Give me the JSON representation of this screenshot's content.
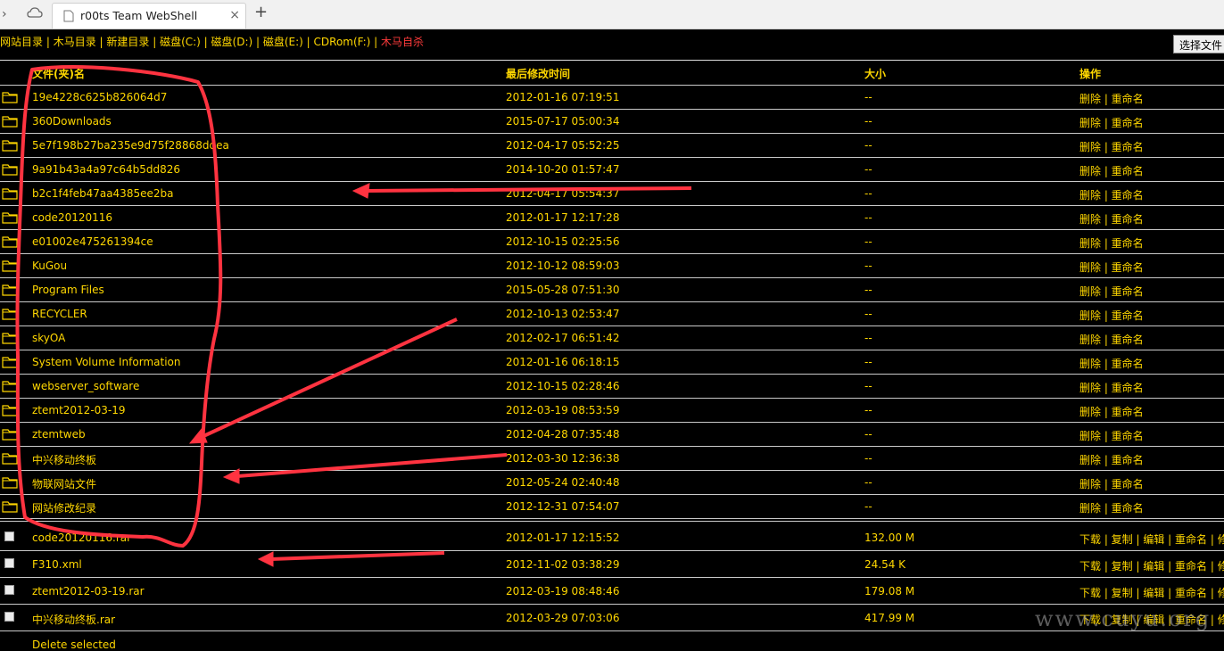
{
  "browser": {
    "tab_title": "r00ts Team WebShell",
    "close_glyph": "×",
    "new_tab_glyph": "+",
    "back_glyph": "›"
  },
  "nav": {
    "items": [
      "网站目录",
      "木马目录",
      "新建目录",
      "磁盘(C:)",
      "磁盘(D:)",
      "磁盘(E:)",
      "CDRom(F:)"
    ],
    "separator": " | ",
    "kill_label": "木马自杀",
    "kill_color": "#ff3b3b"
  },
  "file_button": "选择文件",
  "headers": {
    "name": "文件(夹)名",
    "time": "最后修改时间",
    "size": "大小",
    "ops": "操作"
  },
  "folder_ops": "删除 | 重命名",
  "folders": [
    {
      "name": "19e4228c625b826064d7",
      "time": "2012-01-16 07:19:51",
      "size": "--"
    },
    {
      "name": "360Downloads",
      "time": "2015-07-17 05:00:34",
      "size": "--"
    },
    {
      "name": "5e7f198b27ba235e9d75f28868ddea",
      "time": "2012-04-17 05:52:25",
      "size": "--"
    },
    {
      "name": "9a91b43a4a97c64b5dd826",
      "time": "2014-10-20 01:57:47",
      "size": "--"
    },
    {
      "name": "b2c1f4feb47aa4385ee2ba",
      "time": "2012-04-17 05:54:37",
      "size": "--"
    },
    {
      "name": "code20120116",
      "time": "2012-01-17 12:17:28",
      "size": "--"
    },
    {
      "name": "e01002e475261394ce",
      "time": "2012-10-15 02:25:56",
      "size": "--"
    },
    {
      "name": "KuGou",
      "time": "2012-10-12 08:59:03",
      "size": "--"
    },
    {
      "name": "Program Files",
      "time": "2015-05-28 07:51:30",
      "size": "--"
    },
    {
      "name": "RECYCLER",
      "time": "2012-10-13 02:53:47",
      "size": "--"
    },
    {
      "name": "skyOA",
      "time": "2012-02-17 06:51:42",
      "size": "--"
    },
    {
      "name": "System Volume Information",
      "time": "2012-01-16 06:18:15",
      "size": "--"
    },
    {
      "name": "webserver_software",
      "time": "2012-10-15 02:28:46",
      "size": "--"
    },
    {
      "name": "ztemt2012-03-19",
      "time": "2012-03-19 08:53:59",
      "size": "--"
    },
    {
      "name": "ztemtweb",
      "time": "2012-04-28 07:35:48",
      "size": "--"
    },
    {
      "name": "中兴移动终板",
      "time": "2012-03-30 12:36:38",
      "size": "--"
    },
    {
      "name": "物联网站文件",
      "time": "2012-05-24 02:40:48",
      "size": "--"
    },
    {
      "name": "网站修改纪录",
      "time": "2012-12-31 07:54:07",
      "size": "--"
    }
  ],
  "file_ops": "下载 | 复制 | 编辑 | 重命名 | 修改",
  "files": [
    {
      "name": "code20120116.rar",
      "time": "2012-01-17 12:15:52",
      "size": "132.00 M"
    },
    {
      "name": "F310.xml",
      "time": "2012-11-02 03:38:29",
      "size": "24.54 K"
    },
    {
      "name": "ztemt2012-03-19.rar",
      "time": "2012-03-19 08:48:46",
      "size": "179.08 M"
    },
    {
      "name": "中兴移动终板.rar",
      "time": "2012-03-29 07:03:06",
      "size": "417.99 M"
    }
  ],
  "delete_selected": "Delete selected",
  "watermark": "www.cuyu.org",
  "annotation_color": "#ff3340",
  "text_color": "#FFD700"
}
